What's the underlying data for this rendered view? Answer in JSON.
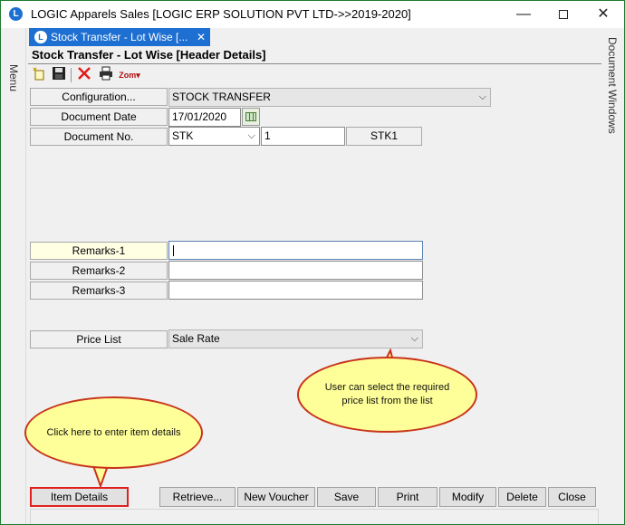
{
  "window": {
    "title": "LOGIC Apparels Sales  [LOGIC ERP SOLUTION PVT LTD->>2019-2020]",
    "logo_letter": "L",
    "minimize": "—",
    "close": "✕"
  },
  "side": {
    "left_label": "Menu",
    "right_label": "Document Windows"
  },
  "tab": {
    "label": "Stock Transfer - Lot Wise [...",
    "close": "✕"
  },
  "form": {
    "title": "Stock Transfer - Lot Wise [Header Details]"
  },
  "toolbar": {
    "zoom_label": "Zom▾"
  },
  "fields": {
    "configuration": {
      "label": "Configuration...",
      "value": "STOCK TRANSFER"
    },
    "document_date": {
      "label": "Document Date",
      "value": "17/01/2020"
    },
    "document_no": {
      "label": "Document No.",
      "series": "STK",
      "number": "1",
      "code": "STK1"
    },
    "remarks1": {
      "label": "Remarks-1",
      "value": ""
    },
    "remarks2": {
      "label": "Remarks-2",
      "value": ""
    },
    "remarks3": {
      "label": "Remarks-3",
      "value": ""
    },
    "price_list": {
      "label": "Price List",
      "value": "Sale Rate"
    }
  },
  "callouts": {
    "price_list_note": "User  can  select  the required  price  list  from the  list",
    "item_details_note": "Click  here  to  enter  item details"
  },
  "buttons": {
    "item_details": "Item Details",
    "retrieve": "Retrieve...",
    "new_voucher": "New Voucher",
    "save": "Save",
    "print": "Print",
    "modify": "Modify",
    "delete": "Delete",
    "close": "Close"
  },
  "colors": {
    "accent": "#1d6fd1",
    "callout_fill": "#ffff99",
    "callout_border": "#c8341a",
    "highlight_border": "#e02020"
  }
}
